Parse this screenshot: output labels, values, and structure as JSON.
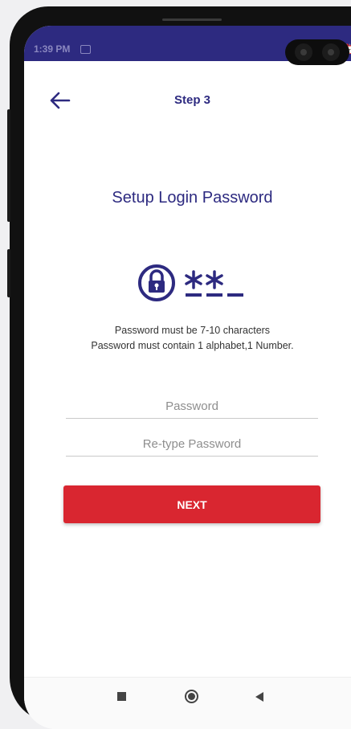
{
  "status_bar": {
    "time": "1:39 PM",
    "message_icon": "message-icon"
  },
  "header": {
    "back_icon": "arrow-left-icon",
    "title": "Step 3"
  },
  "main": {
    "heading": "Setup Login Password",
    "illustration_icon": "lock-password-icon",
    "rules": [
      "Password must be 7-10 characters",
      "Password must contain 1 alphabet,1 Number."
    ],
    "password_placeholder": "Password",
    "password_value": "",
    "retype_placeholder": "Re-type Password",
    "retype_value": "",
    "next_label": "NEXT"
  },
  "nav_bar": {
    "recents_icon": "square-icon",
    "home_icon": "circle-icon",
    "back_icon": "triangle-back-icon"
  },
  "colors": {
    "brand": "#2d2a80",
    "primary_button": "#d92630",
    "background": "#ffffff"
  }
}
